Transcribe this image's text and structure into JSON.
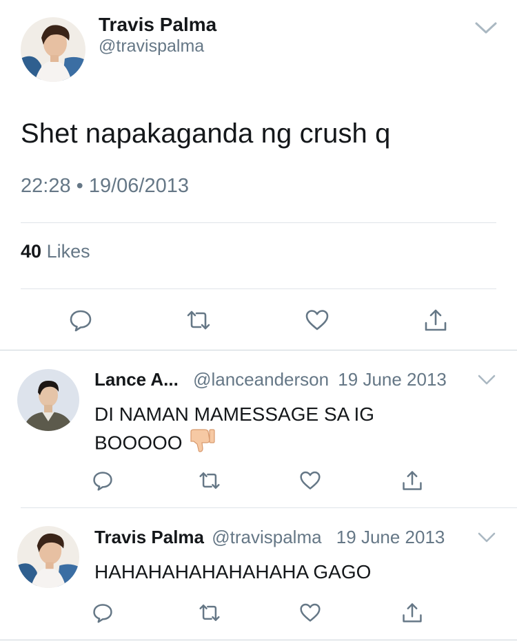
{
  "main_tweet": {
    "author_name": "Travis Palma",
    "author_handle": "@travispalma",
    "text": "Shet napakaganda ng crush q",
    "time": "22:28",
    "separator": "•",
    "date": "19/06/2013",
    "likes_count": "40",
    "likes_label": "Likes",
    "icons": [
      "reply-icon",
      "retweet-icon",
      "like-icon",
      "share-icon"
    ]
  },
  "replies": [
    {
      "author_name": "Lance A...",
      "author_handle": "@lanceanderson",
      "date": "19 June 2013",
      "text": "DI NAMAN MAMESSAGE SA IG BOOOOO",
      "emoji": "thumbs-down-icon"
    },
    {
      "author_name": "Travis Palma",
      "author_handle": "@travispalma",
      "date": "19 June 2013",
      "text": "HAHAHAHAHAHAHAHA GAGO"
    }
  ],
  "colors": {
    "text_primary": "#14171a",
    "text_secondary": "#657786",
    "divider": "#dfe3e8",
    "icon": "#657786"
  }
}
